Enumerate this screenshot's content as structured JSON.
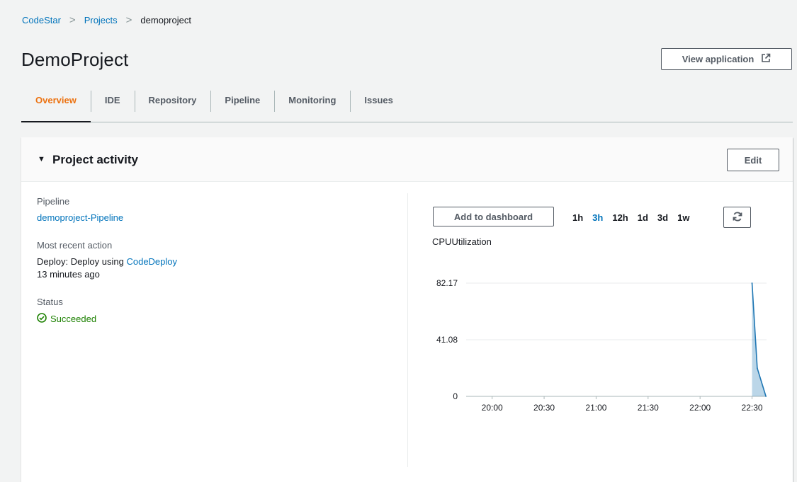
{
  "breadcrumb": {
    "root": "CodeStar",
    "projects": "Projects",
    "current": "demoproject"
  },
  "page_title": "DemoProject",
  "view_app_label": "View application",
  "tabs": [
    {
      "label": "Overview",
      "active": true
    },
    {
      "label": "IDE"
    },
    {
      "label": "Repository"
    },
    {
      "label": "Pipeline"
    },
    {
      "label": "Monitoring"
    },
    {
      "label": "Issues"
    }
  ],
  "activity": {
    "title": "Project activity",
    "edit_label": "Edit",
    "pipeline_label": "Pipeline",
    "pipeline_link": "demoproject-Pipeline",
    "recent_label": "Most recent action",
    "recent_prefix": "Deploy: Deploy using ",
    "recent_link": "CodeDeploy",
    "recent_time": "13 minutes ago",
    "status_label": "Status",
    "status_value": "Succeeded"
  },
  "metrics": {
    "add_dashboard_label": "Add to dashboard",
    "ranges": [
      "1h",
      "3h",
      "12h",
      "1d",
      "3d",
      "1w"
    ],
    "selected_range": "3h",
    "metric_name": "CPUUtilization"
  },
  "colors": {
    "link": "#0073bb",
    "tab_active": "#ec7211",
    "success": "#1d8102",
    "series": "#1f77b4"
  },
  "chart_data": {
    "type": "area",
    "title": "CPUUtilization",
    "yticks": [
      0,
      41.08,
      82.17
    ],
    "ylim": [
      0,
      82.17
    ],
    "xticks": [
      "20:00",
      "20:30",
      "21:00",
      "21:30",
      "22:00",
      "22:30"
    ],
    "xlim_minutes": [
      1185,
      1360
    ],
    "series": [
      {
        "x": [
          "22:30",
          "22:33",
          "22:38"
        ],
        "y": [
          82.17,
          20.5,
          0
        ]
      }
    ]
  }
}
